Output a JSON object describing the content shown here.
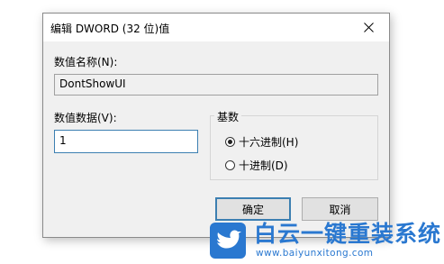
{
  "dialog": {
    "title": "编辑 DWORD (32 位)值",
    "close_icon": "close-icon"
  },
  "value_name": {
    "label": "数值名称(N):",
    "value": "DontShowUI"
  },
  "value_data": {
    "label": "数值数据(V):",
    "value": "1"
  },
  "base": {
    "title": "基数",
    "options": [
      {
        "label": "十六进制(H)",
        "checked": true
      },
      {
        "label": "十进制(D)",
        "checked": false
      }
    ]
  },
  "buttons": {
    "ok": "确定",
    "cancel": "取消"
  },
  "watermark": {
    "title": "白云一键重装系统",
    "url": "www.baiyunxitong.com",
    "logo_icon": "bird-logo-icon"
  }
}
